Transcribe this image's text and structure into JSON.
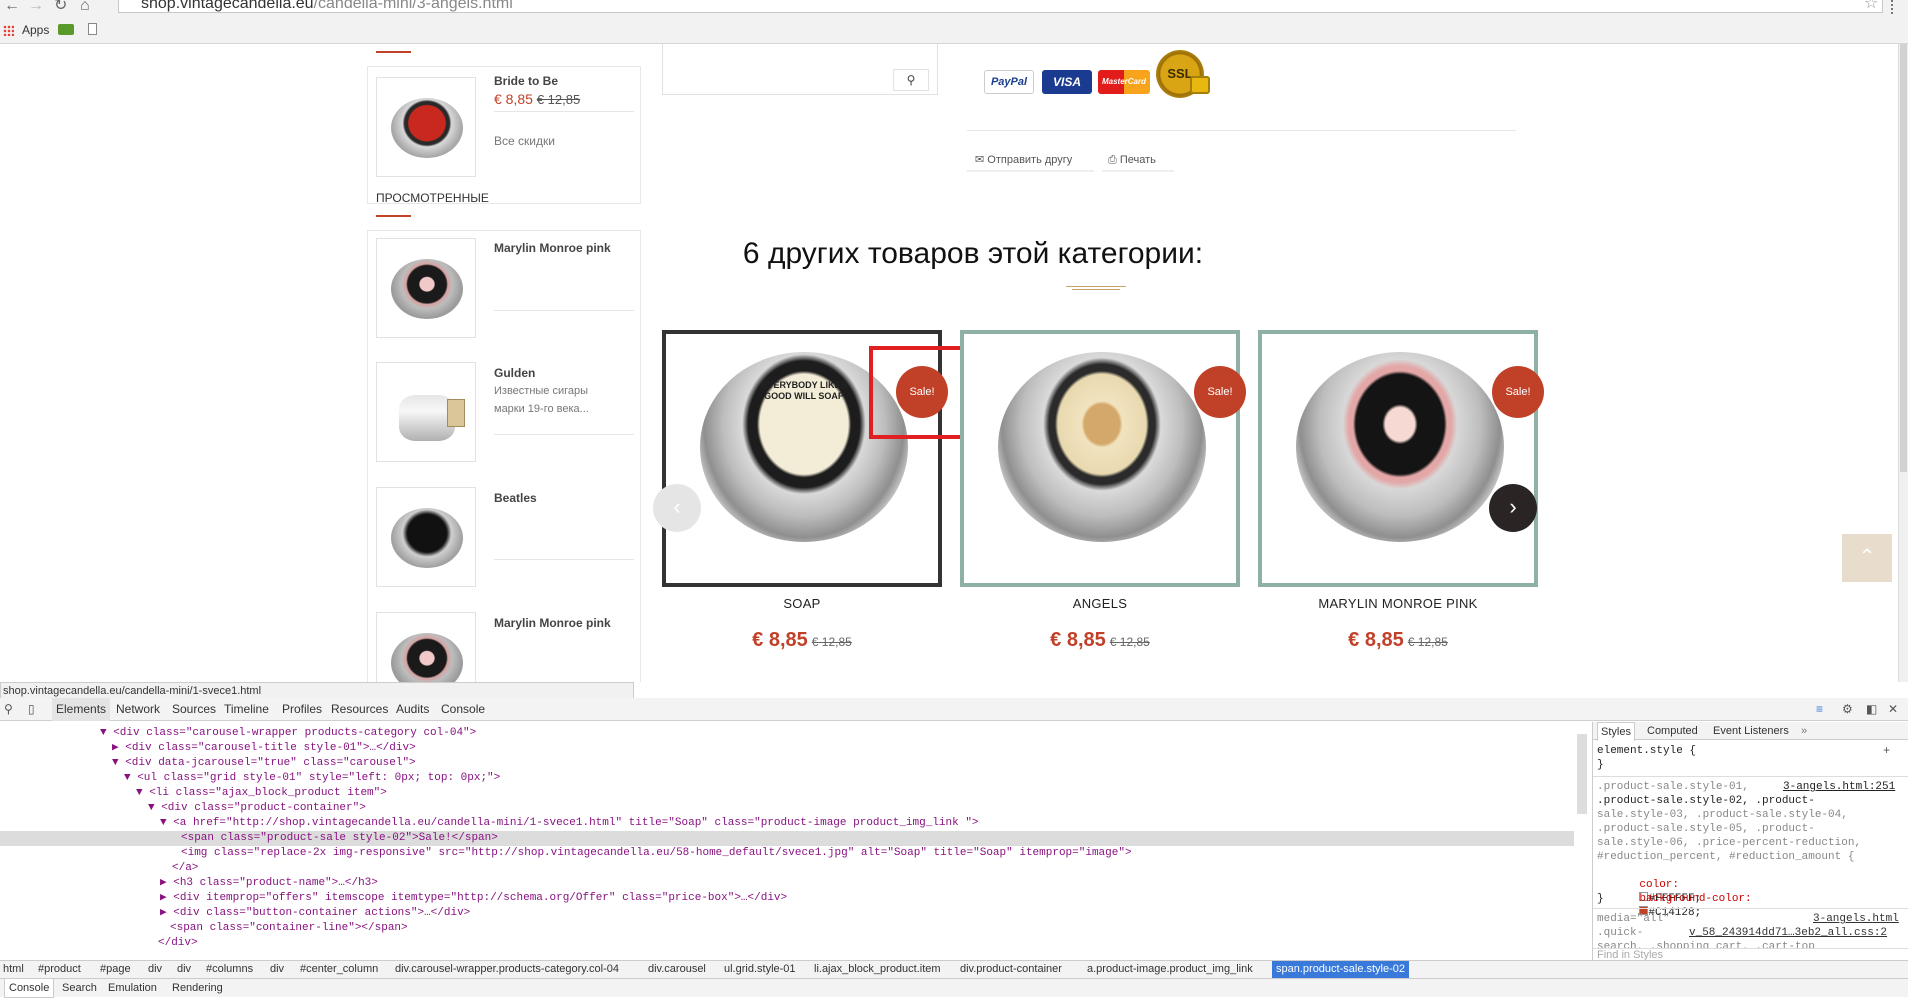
{
  "browser": {
    "url_host": "shop.vintagecandella.eu",
    "url_path": "/candella-mini/3-angels.html",
    "bookmarks": [
      "Apps"
    ]
  },
  "sidebar": {
    "featured": {
      "name": "Bride to Be",
      "price": "€ 8,85",
      "old_price": "€ 12,85",
      "all_discounts": "Все скидки"
    },
    "viewed_title": "ПРОСМОТРЕННЫЕ",
    "viewed": [
      {
        "name": "Marylin Monroe pink",
        "desc": ""
      },
      {
        "name": "Gulden",
        "desc": "Известные сигары марки 19-го века..."
      },
      {
        "name": "Beatles",
        "desc": ""
      },
      {
        "name": "Marylin Monroe pink",
        "desc": ""
      }
    ]
  },
  "actions": {
    "send_friend": "Отправить другу",
    "print": "Печать"
  },
  "payment": [
    "PayPal",
    "VISA",
    "MasterCard",
    "SSL"
  ],
  "carousel": {
    "title": "6 других товаров этой категории:",
    "sale_label": "Sale!",
    "products": [
      {
        "name": "SOAP",
        "price": "€ 8,85",
        "old_price": "€ 12,85",
        "label": "EVERYBODY LIKES GOOD WILL SOAP"
      },
      {
        "name": "ANGELS",
        "price": "€ 8,85",
        "old_price": "€ 12,85",
        "label": ""
      },
      {
        "name": "MARYLIN MONROE PINK",
        "price": "€ 8,85",
        "old_price": "€ 12,85",
        "label": ""
      }
    ]
  },
  "status_url": "shop.vintagecandella.eu/candella-mini/1-svece1.html",
  "devtools": {
    "tabs": [
      "Elements",
      "Network",
      "Sources",
      "Timeline",
      "Profiles",
      "Resources",
      "Audits",
      "Console"
    ],
    "active_tab": "Elements",
    "code": [
      "<div class=\"carousel-wrapper products-category col-04\">",
      "<div class=\"carousel-title style-01\">…</div>",
      "<div data-jcarousel=\"true\" class=\"carousel\">",
      "<ul class=\"grid style-01\" style=\"left: 0px; top: 0px;\">",
      "<li class=\"ajax_block_product item\">",
      "<div class=\"product-container\">",
      "<a href=\"http://shop.vintagecandella.eu/candella-mini/1-svece1.html\" title=\"Soap\" class=\"product-image product_img_link \">",
      "<span class=\"product-sale style-02\">Sale!</span>",
      "<img class=\"replace-2x img-responsive\" src=\"http://shop.vintagecandella.eu/58-home_default/svece1.jpg\" alt=\"Soap\" title=\"Soap\" itemprop=\"image\">",
      "</a>",
      "<h3 class=\"product-name\">…</h3>",
      "<div itemprop=\"offers\" itemscope itemtype=\"http://schema.org/Offer\" class=\"price-box\">…</div>",
      "<div class=\"button-container actions\">…</div>",
      "<span class=\"container-line\"></span>",
      "</div>"
    ],
    "style_tabs": [
      "Styles",
      "Computed",
      "Event Listeners"
    ],
    "styles": {
      "element_style": "element.style {",
      "close": "}",
      "rule_source": "3-angels.html:251",
      "selector_lines": [
        ".product-sale.style-01,",
        ".product-sale.style-02, .product-",
        "sale.style-03, .product-sale.style-04,",
        ".product-sale.style-05, .product-",
        "sale.style-06, .price-percent-reduction,",
        "#reduction_percent, #reduction_amount {"
      ],
      "prop1_name": "color:",
      "prop1_value": "#FFFFFF;",
      "prop2_name": "background-color:",
      "prop2_value": "#C14128;",
      "media": "media=\"all\"",
      "media_source": "3-angels.html",
      "quick": ".quick-",
      "quick_source": "v_58_243914dd71…3eb2_all.css:2",
      "search_line": "search, .shopping_cart, .cart-top",
      "find": "Find in Styles"
    },
    "breadcrumbs": [
      "html",
      "#product",
      "#page",
      "div",
      "div",
      "#columns",
      "div",
      "#center_column",
      "div.carousel-wrapper.products-category.col-04",
      "div.carousel",
      "ul.grid.style-01",
      "li.ajax_block_product.item",
      "div.product-container",
      "a.product-image.product_img_link",
      "span.product-sale.style-02"
    ],
    "drawer_tabs": [
      "Console",
      "Search",
      "Emulation",
      "Rendering"
    ]
  },
  "colors": {
    "accent": "#c14128",
    "frame_selected": "#333333",
    "frame_default": "#8fb0a4",
    "highlight": "#e02020"
  }
}
